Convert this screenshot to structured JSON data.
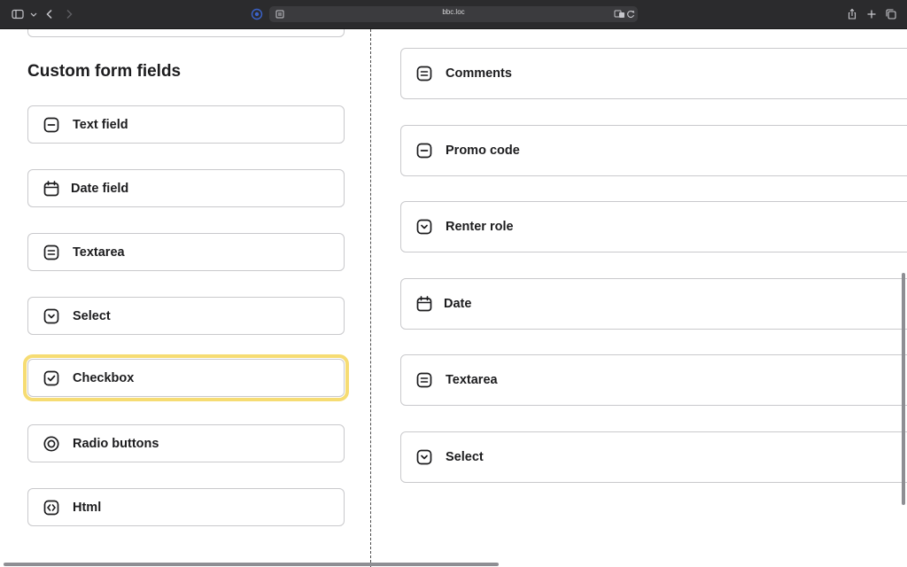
{
  "browser": {
    "address": "bbc.loc"
  },
  "section": {
    "title": "Custom form fields"
  },
  "left_fields": [
    {
      "label": "Text field",
      "icon": "minus-square-icon"
    },
    {
      "label": "Date field",
      "icon": "calendar-icon"
    },
    {
      "label": "Textarea",
      "icon": "equals-square-icon"
    },
    {
      "label": "Select",
      "icon": "chevron-down-square-icon"
    },
    {
      "label": "Checkbox",
      "icon": "check-square-icon"
    },
    {
      "label": "Radio buttons",
      "icon": "radio-circle-icon"
    },
    {
      "label": "Html",
      "icon": "code-square-icon"
    }
  ],
  "right_fields": [
    {
      "label": "Comments",
      "icon": "equals-square-icon"
    },
    {
      "label": "Promo code",
      "icon": "minus-square-icon"
    },
    {
      "label": "Renter role",
      "icon": "chevron-down-square-icon"
    },
    {
      "label": "Date",
      "icon": "calendar-icon"
    },
    {
      "label": "Textarea",
      "icon": "equals-square-icon"
    },
    {
      "label": "Select",
      "icon": "chevron-down-square-icon"
    }
  ],
  "colors": {
    "highlight": "#f6dc73",
    "border": "#c9c9cc",
    "chrome": "#2b2b2d"
  }
}
